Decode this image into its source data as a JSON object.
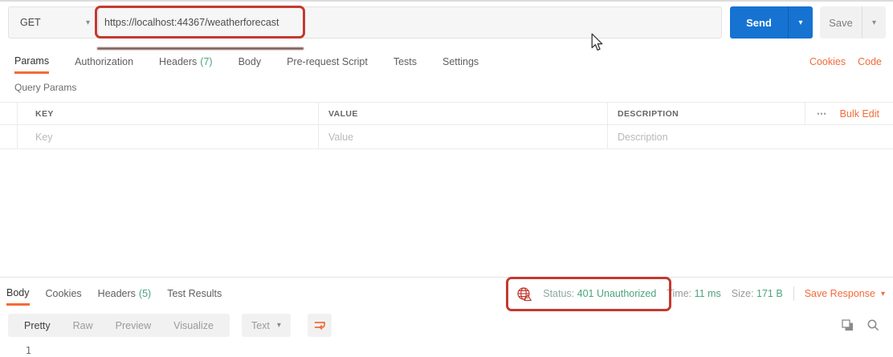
{
  "request_bar": {
    "method": "GET",
    "url": "https://localhost:44367/weatherforecast",
    "send_label": "Send",
    "save_label": "Save"
  },
  "request_tabs": {
    "items": [
      {
        "label": "Params"
      },
      {
        "label": "Authorization"
      },
      {
        "label": "Headers",
        "count": "(7)"
      },
      {
        "label": "Body"
      },
      {
        "label": "Pre-request Script"
      },
      {
        "label": "Tests"
      },
      {
        "label": "Settings"
      }
    ],
    "cookies_link": "Cookies",
    "code_link": "Code"
  },
  "query_params": {
    "section_title": "Query Params",
    "columns": {
      "key": "KEY",
      "value": "VALUE",
      "description": "DESCRIPTION"
    },
    "bulk_edit_link": "Bulk Edit",
    "placeholder_row": {
      "key": "Key",
      "value": "Value",
      "description": "Description"
    }
  },
  "response": {
    "tabs": [
      {
        "label": "Body"
      },
      {
        "label": "Cookies"
      },
      {
        "label": "Headers",
        "count": "(5)"
      },
      {
        "label": "Test Results"
      }
    ],
    "meta": {
      "status_label": "Status:",
      "status_value": "401 Unauthorized",
      "time_label": "Time:",
      "time_value": "11 ms",
      "size_label": "Size:",
      "size_value": "171 B",
      "save_response_label": "Save Response"
    },
    "toolbar": {
      "views": [
        {
          "label": "Pretty"
        },
        {
          "label": "Raw"
        },
        {
          "label": "Preview"
        },
        {
          "label": "Visualize"
        }
      ],
      "active_view": "Pretty",
      "format_selected": "Text"
    },
    "editor": {
      "line_number": "1"
    }
  },
  "icons": {
    "caret_down": "▾",
    "more_options": "•••"
  },
  "colors": {
    "accent_orange": "#f26b3a",
    "send_blue": "#1673d2",
    "green": "#4ba47d",
    "annotation_red": "#c4392f",
    "placeholder_gray": "#b9b9b9"
  }
}
